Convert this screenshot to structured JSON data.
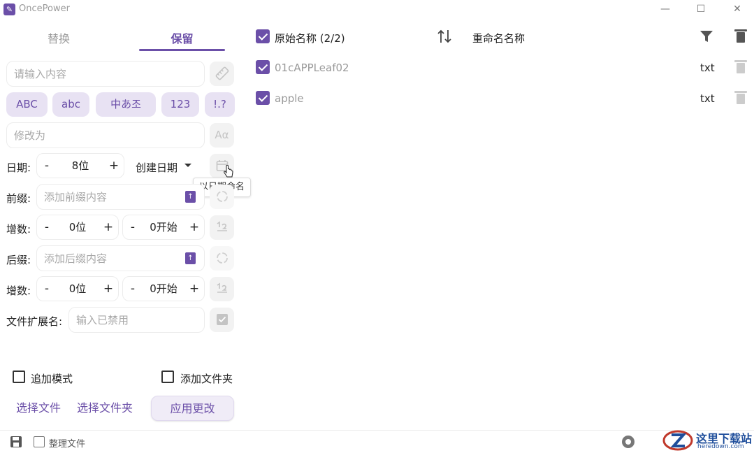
{
  "window": {
    "title": "OncePower",
    "minimize": "—",
    "maximize": "☐",
    "close": "✕"
  },
  "tabs": [
    {
      "label": "替换"
    },
    {
      "label": "保留"
    }
  ],
  "left": {
    "content_placeholder": "请输入内容",
    "chips": [
      "ABC",
      "abc",
      "中あ조",
      "123",
      "!.?"
    ],
    "modify_placeholder": "修改为",
    "aa_label": "Aα",
    "date": {
      "label": "日期:",
      "digits": "8位",
      "type": "创建日期",
      "tooltip": "以日期命名"
    },
    "prefix": {
      "label": "前缀:",
      "placeholder": "添加前缀内容"
    },
    "increment1": {
      "label": "增数:",
      "digits": "0位",
      "start": "0开始"
    },
    "suffix": {
      "label": "后缀:",
      "placeholder": "添加后缀内容"
    },
    "increment2": {
      "label": "增数:",
      "digits": "0位",
      "start": "0开始"
    },
    "extension": {
      "label": "文件扩展名:",
      "placeholder": "输入已禁用"
    },
    "append_mode": "追加模式",
    "add_folder": "添加文件夹",
    "select_file": "选择文件",
    "select_folder": "选择文件夹",
    "apply": "应用更改",
    "organize": "整理文件"
  },
  "right": {
    "header": {
      "original": "原始名称 (2/2)",
      "renamed": "重命名名称"
    },
    "rows": [
      {
        "name": "01cAPPLeaf02",
        "ext": "txt"
      },
      {
        "name": "apple",
        "ext": "txt"
      }
    ]
  },
  "colors": {
    "accent": "#6b4fa8",
    "chip_bg": "#e8e2f3"
  },
  "watermark": {
    "brand": "这里下载站",
    "site": "heredown.com"
  }
}
